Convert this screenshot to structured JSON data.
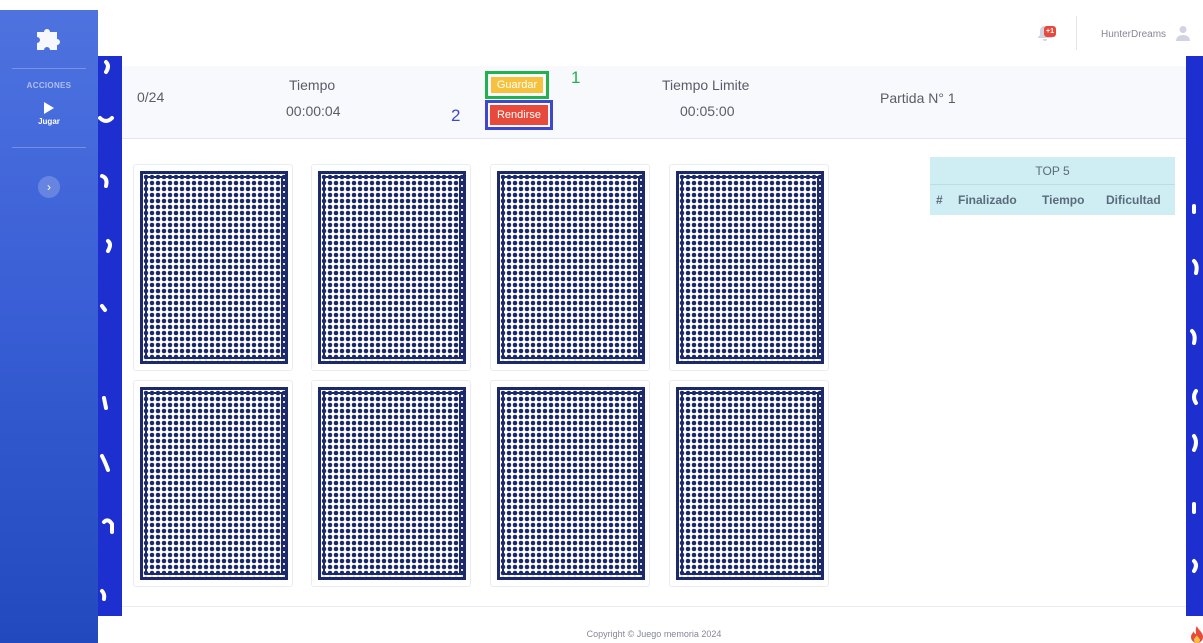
{
  "sidebar": {
    "logo_icon": "puzzle-piece-icon",
    "heading": "ACCIONES",
    "nav_item_label": "Jugar",
    "nav_item_icon": "play-icon",
    "toggle_icon": "chevron-right-icon",
    "toggle_glyph": "›"
  },
  "topbar": {
    "notification_badge": "+1",
    "notification_icon": "bell-icon",
    "username": "HunterDreams",
    "user_icon": "user-icon"
  },
  "header": {
    "counter": "0/24",
    "time_label": "Tiempo",
    "time_value": "00:00:04",
    "save_label": "Guardar",
    "quit_label": "Rendirse",
    "annotation_1": "1",
    "annotation_2": "2",
    "limit_label": "Tiempo Limite",
    "limit_value": "00:05:00",
    "match_label": "Partida N° 1"
  },
  "board": {
    "card_count": 8
  },
  "top5": {
    "title": "TOP 5",
    "columns": [
      "#",
      "Finalizado",
      "Tiempo",
      "Dificultad"
    ]
  },
  "footer": {
    "copyright": "Copyright © Juego memoria 2024"
  },
  "colors": {
    "sidebar_gradient_top": "#4e73df",
    "strip_blue": "#1e2fd0",
    "card_blue": "#1c2a6a",
    "save_button": "#f6c23e",
    "quit_button": "#e74a3b",
    "annotation_green": "#22b14c",
    "annotation_blue": "#3f48cc",
    "table_header": "#cfeef3"
  }
}
